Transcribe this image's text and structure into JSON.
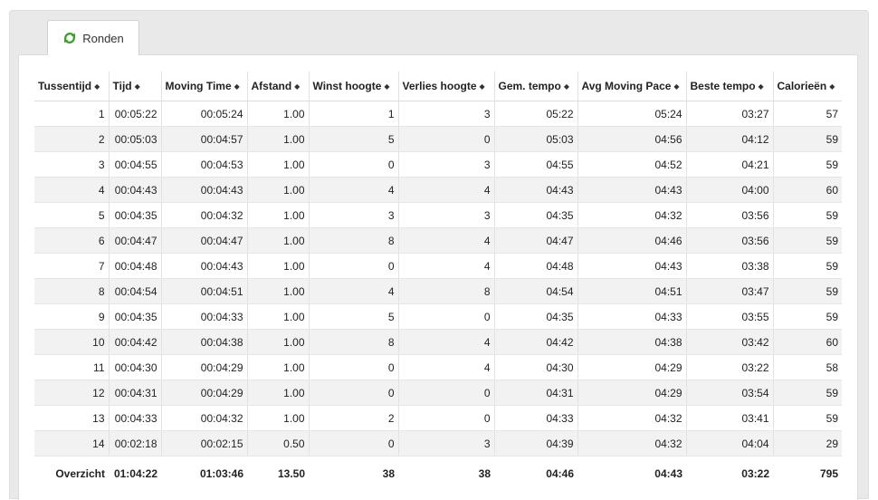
{
  "tab": {
    "label": "Ronden",
    "icon": "refresh-icon"
  },
  "table": {
    "columns": [
      "Tussentijd",
      "Tijd",
      "Moving Time",
      "Afstand",
      "Winst hoogte",
      "Verlies hoogte",
      "Gem. tempo",
      "Avg Moving Pace",
      "Beste tempo",
      "Calorieën"
    ],
    "rows": [
      [
        "1",
        "00:05:22",
        "00:05:24",
        "1.00",
        "1",
        "3",
        "05:22",
        "05:24",
        "03:27",
        "57"
      ],
      [
        "2",
        "00:05:03",
        "00:04:57",
        "1.00",
        "5",
        "0",
        "05:03",
        "04:56",
        "04:12",
        "59"
      ],
      [
        "3",
        "00:04:55",
        "00:04:53",
        "1.00",
        "0",
        "3",
        "04:55",
        "04:52",
        "04:21",
        "59"
      ],
      [
        "4",
        "00:04:43",
        "00:04:43",
        "1.00",
        "4",
        "4",
        "04:43",
        "04:43",
        "04:00",
        "60"
      ],
      [
        "5",
        "00:04:35",
        "00:04:32",
        "1.00",
        "3",
        "3",
        "04:35",
        "04:32",
        "03:56",
        "59"
      ],
      [
        "6",
        "00:04:47",
        "00:04:47",
        "1.00",
        "8",
        "4",
        "04:47",
        "04:46",
        "03:56",
        "59"
      ],
      [
        "7",
        "00:04:48",
        "00:04:43",
        "1.00",
        "0",
        "4",
        "04:48",
        "04:43",
        "03:38",
        "59"
      ],
      [
        "8",
        "00:04:54",
        "00:04:51",
        "1.00",
        "4",
        "8",
        "04:54",
        "04:51",
        "03:47",
        "59"
      ],
      [
        "9",
        "00:04:35",
        "00:04:33",
        "1.00",
        "5",
        "0",
        "04:35",
        "04:33",
        "03:55",
        "59"
      ],
      [
        "10",
        "00:04:42",
        "00:04:38",
        "1.00",
        "8",
        "4",
        "04:42",
        "04:38",
        "03:42",
        "60"
      ],
      [
        "11",
        "00:04:30",
        "00:04:29",
        "1.00",
        "0",
        "4",
        "04:30",
        "04:29",
        "03:22",
        "58"
      ],
      [
        "12",
        "00:04:31",
        "00:04:29",
        "1.00",
        "0",
        "0",
        "04:31",
        "04:29",
        "03:54",
        "59"
      ],
      [
        "13",
        "00:04:33",
        "00:04:32",
        "1.00",
        "2",
        "0",
        "04:33",
        "04:32",
        "03:41",
        "59"
      ],
      [
        "14",
        "00:02:18",
        "00:02:15",
        "0.50",
        "0",
        "3",
        "04:39",
        "04:32",
        "04:04",
        "29"
      ]
    ],
    "summary": [
      "Overzicht",
      "01:04:22",
      "01:03:46",
      "13.50",
      "38",
      "38",
      "04:46",
      "04:43",
      "03:22",
      "795"
    ]
  },
  "colors": {
    "accent_icon": "#3aa02a",
    "panel_bg": "#e9e9e9",
    "stripe": "#f2f2f2"
  }
}
